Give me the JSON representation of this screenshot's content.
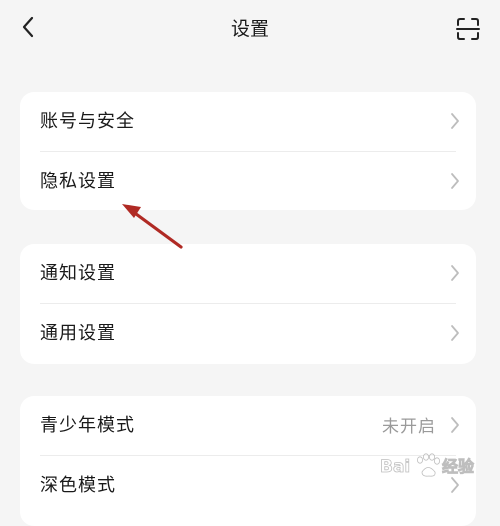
{
  "header": {
    "title": "设置",
    "back_icon": "chevron-left-icon",
    "scan_icon": "scan-icon"
  },
  "groups": [
    {
      "items": [
        {
          "label": "账号与安全"
        },
        {
          "label": "隐私设置"
        }
      ]
    },
    {
      "items": [
        {
          "label": "通知设置"
        },
        {
          "label": "通用设置"
        }
      ]
    },
    {
      "items": [
        {
          "label": "青少年模式",
          "value": "未开启"
        },
        {
          "label": "深色模式"
        }
      ]
    }
  ],
  "annotation": {
    "type": "arrow",
    "color": "#b02a24"
  },
  "watermark": {
    "text": "Bai du 经验",
    "logo": "baidu-paw-logo"
  }
}
